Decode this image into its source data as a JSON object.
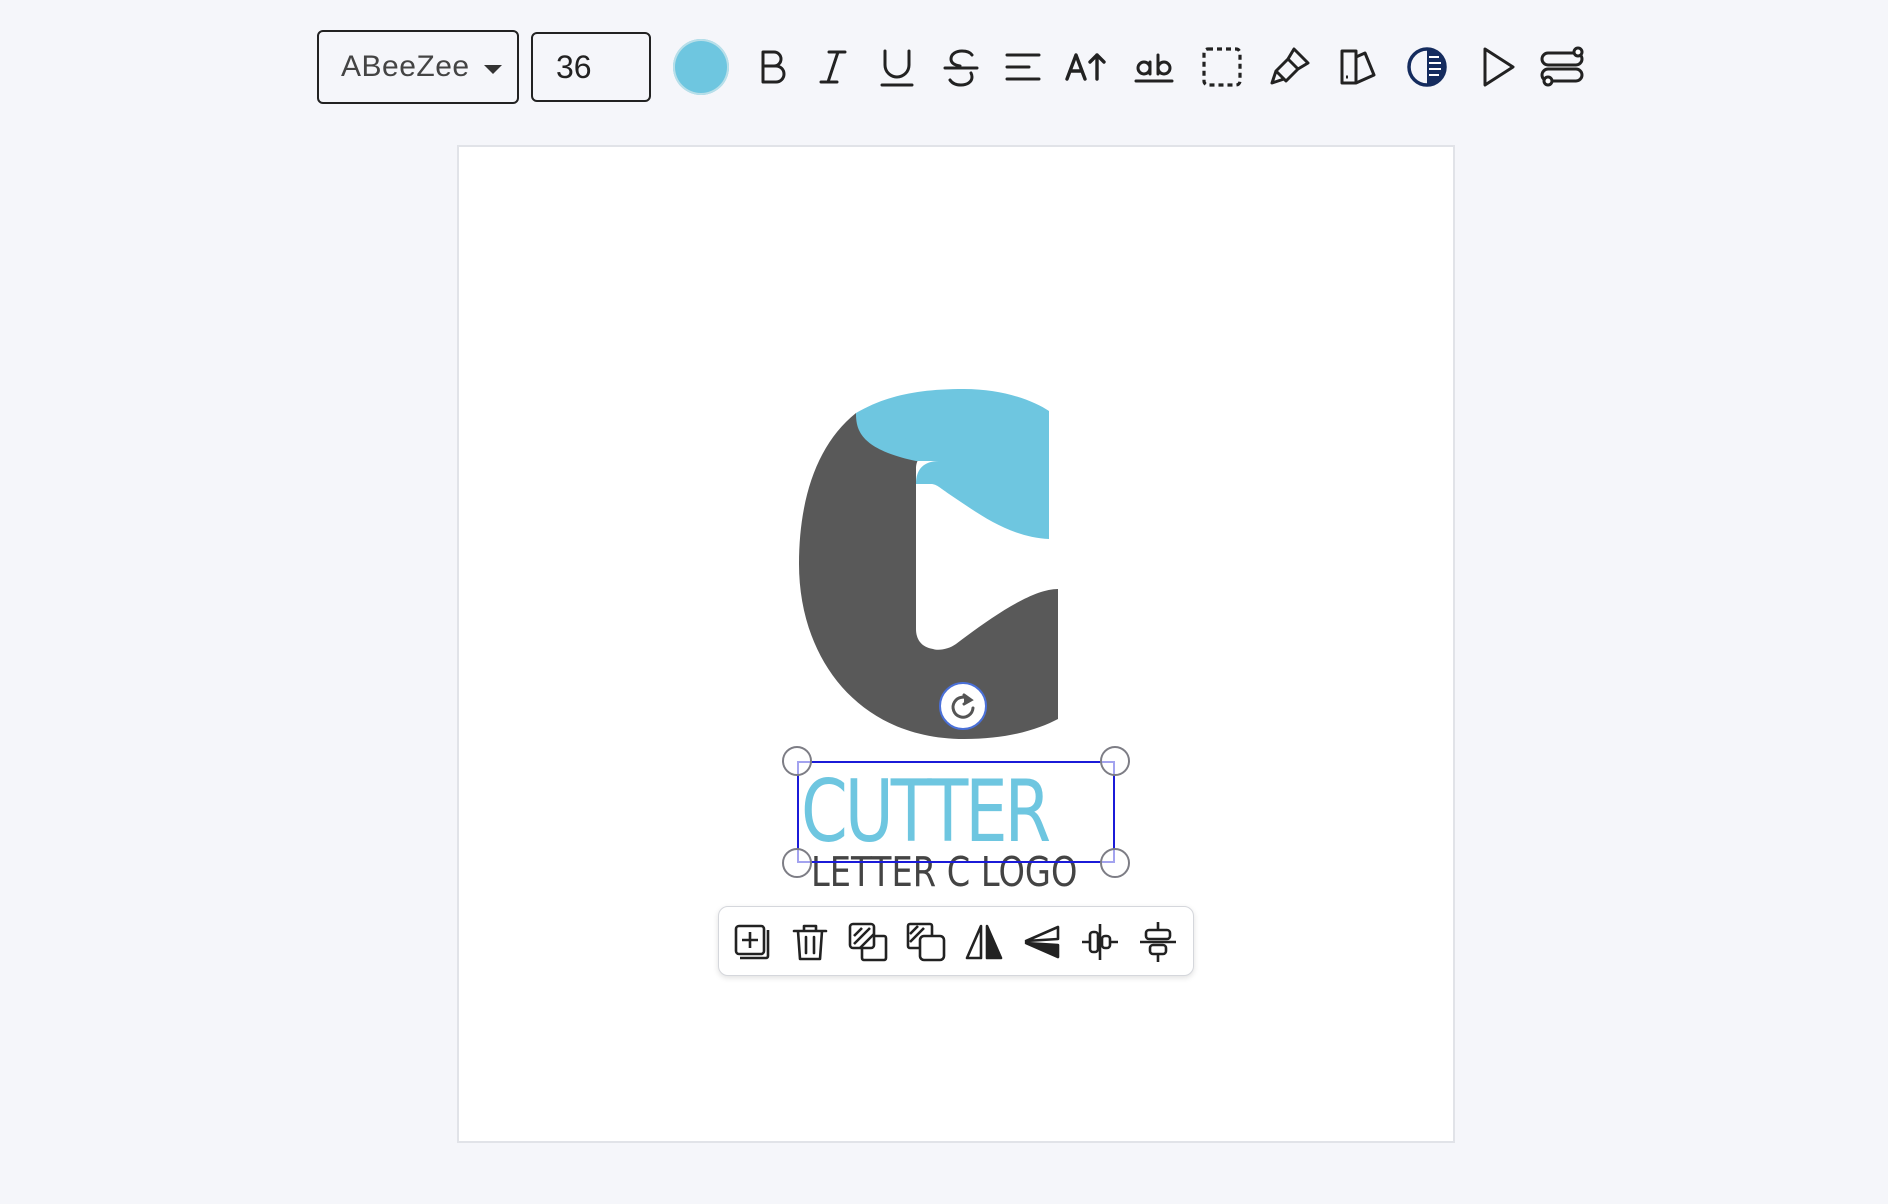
{
  "toolbar": {
    "font_family": "ABeeZee",
    "font_size": "36",
    "text_color": "#6ec6e0",
    "icons": [
      "bold-icon",
      "italic-icon",
      "underline-icon",
      "strikethrough-icon",
      "align-icon",
      "text-size-icon",
      "spell-check-icon",
      "selection-icon",
      "brush-icon",
      "swatch-icon",
      "contrast-icon",
      "play-icon",
      "settings-icon"
    ]
  },
  "canvas": {
    "logo_colors": {
      "primary": "#6ec6e0",
      "secondary": "#595959"
    },
    "title_text": "CUTTER",
    "subtitle_text": "LETTER C LOGO",
    "selection_color": "#1b1bd8"
  },
  "context_toolbar": {
    "icons": [
      "add-icon",
      "delete-icon",
      "bring-forward-icon",
      "send-backward-icon",
      "flip-horizontal-icon",
      "flip-vertical-icon",
      "align-center-horizontal-icon",
      "align-center-vertical-icon"
    ]
  }
}
